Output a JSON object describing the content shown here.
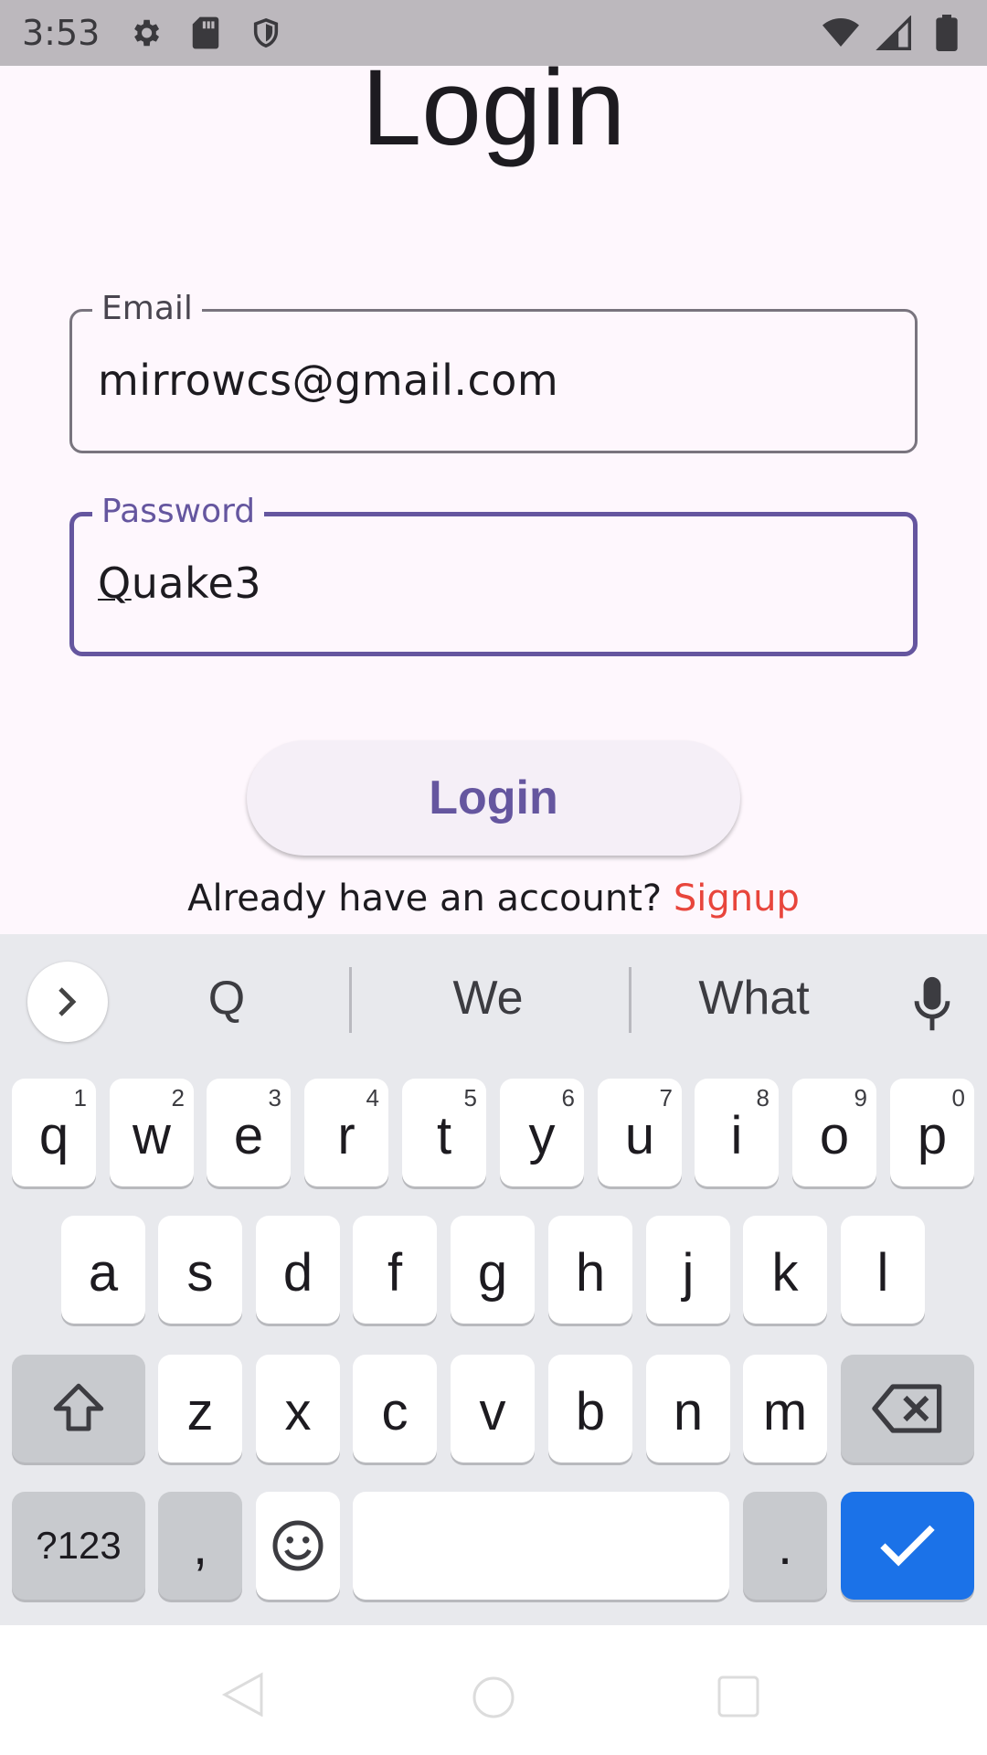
{
  "status_bar": {
    "time": "3:53",
    "left_icons": [
      "settings-icon",
      "sd-card-icon",
      "shield-icon"
    ],
    "right_icons": [
      "wifi-icon",
      "signal-icon",
      "battery-icon"
    ]
  },
  "screen": {
    "title": "Login",
    "email": {
      "label": "Email",
      "value": "mirrowcs@gmail.com"
    },
    "password": {
      "label": "Password",
      "value_first": "Q",
      "value_rest": "uake3"
    },
    "login_button": "Login",
    "signup_prompt": "Already have an account?",
    "signup_link": "Signup"
  },
  "colors": {
    "accent": "#65569f",
    "link": "#e8453c",
    "keyboard_bg": "#e8e9ed",
    "enter_key": "#1b72e8"
  },
  "keyboard": {
    "suggestions": [
      "Q",
      "We",
      "What"
    ],
    "row1": [
      {
        "key": "q",
        "hint": "1"
      },
      {
        "key": "w",
        "hint": "2"
      },
      {
        "key": "e",
        "hint": "3"
      },
      {
        "key": "r",
        "hint": "4"
      },
      {
        "key": "t",
        "hint": "5"
      },
      {
        "key": "y",
        "hint": "6"
      },
      {
        "key": "u",
        "hint": "7"
      },
      {
        "key": "i",
        "hint": "8"
      },
      {
        "key": "o",
        "hint": "9"
      },
      {
        "key": "p",
        "hint": "0"
      }
    ],
    "row2": [
      "a",
      "s",
      "d",
      "f",
      "g",
      "h",
      "j",
      "k",
      "l"
    ],
    "row3": [
      "z",
      "x",
      "c",
      "v",
      "b",
      "n",
      "m"
    ],
    "symbols_key": "?123",
    "comma_key": ",",
    "period_key": "."
  },
  "nav_bar": {
    "icons": [
      "back-icon",
      "home-icon",
      "recents-icon"
    ]
  }
}
